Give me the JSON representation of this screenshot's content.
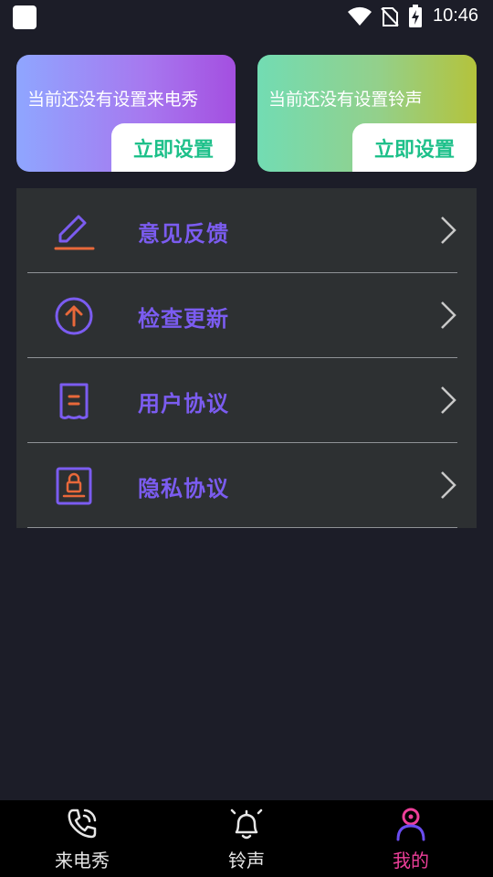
{
  "status_bar": {
    "time": "10:46"
  },
  "cards": [
    {
      "text": "当前还没有设置来电秀",
      "button": "立即设置"
    },
    {
      "text": "当前还没有设置铃声",
      "button": "立即设置"
    }
  ],
  "menu": [
    {
      "label": "意见反馈",
      "icon": "edit-icon"
    },
    {
      "label": "检查更新",
      "icon": "upload-icon"
    },
    {
      "label": "用户协议",
      "icon": "document-icon"
    },
    {
      "label": "隐私协议",
      "icon": "lock-document-icon"
    }
  ],
  "bottom_nav": [
    {
      "label": "来电秀",
      "icon": "phone-icon",
      "active": false
    },
    {
      "label": "铃声",
      "icon": "bell-icon",
      "active": false
    },
    {
      "label": "我的",
      "icon": "user-icon",
      "active": true
    }
  ],
  "colors": {
    "accent": "#7b5cf0",
    "icon_orange": "#e8683a",
    "active_tab": "#ee3f9a",
    "button_text": "#1ec08a"
  }
}
